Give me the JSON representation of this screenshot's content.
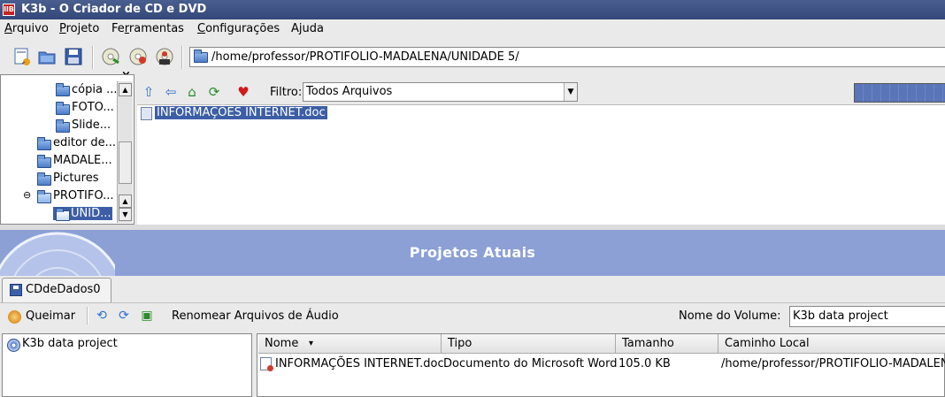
{
  "window": {
    "title": "K3b - O Criador de CD e DVD",
    "app_icon_text": "llB"
  },
  "menubar": [
    {
      "label": "Arquivo",
      "underline": 0
    },
    {
      "label": "Projeto",
      "underline": 0
    },
    {
      "label": "Ferramentas",
      "underline": 2
    },
    {
      "label": "Configurações",
      "underline": 0
    },
    {
      "label": "Ajuda",
      "underline": 1
    }
  ],
  "toolbar": {
    "path": "/home/professor/PROTIFOLIO-MADALENA/UNIDADE 5/",
    "icons": [
      "new-project-icon",
      "open-project-icon",
      "save-project-icon",
      "copy-cd-icon",
      "burn-cd-image-icon",
      "burn-dvd-image-icon"
    ]
  },
  "tree": {
    "close_glyph": "×",
    "items": [
      {
        "label": "cópia ...",
        "indent": 3
      },
      {
        "label": "FOTO...",
        "indent": 3
      },
      {
        "label": "Slide...",
        "indent": 3
      },
      {
        "label": "editor de...",
        "indent": 2
      },
      {
        "label": "MADALE...",
        "indent": 2
      },
      {
        "label": "Pictures",
        "indent": 2
      },
      {
        "label": "PROTIFO...",
        "indent": 2,
        "expanded": true,
        "expander": "⊖"
      },
      {
        "label": "UNID...",
        "indent": 3,
        "selected": true
      }
    ]
  },
  "filebrowser": {
    "nav_icons": [
      "up-arrow-icon",
      "back-arrow-icon",
      "home-icon",
      "reload-icon",
      "bookmark-heart-icon"
    ],
    "filter_label": "Filtro:",
    "filter_value": "Todos Arquivos",
    "files": [
      {
        "name": "INFORMAÇÕES INTERNET.doc",
        "selected": true
      }
    ]
  },
  "projects": {
    "header_title": "Projetos Atuais",
    "tab_label": "CDdeDados0",
    "burn_label": "Queimar",
    "rename_audio_label": "Renomear Arquivos de Áudio",
    "volume_label": "Nome do Volume:",
    "volume_value": "K3b data project",
    "root_label": "K3b data project",
    "columns": [
      "Nome",
      "Tipo",
      "Tamanho",
      "Caminho Local"
    ],
    "sort_indicator": "▾",
    "rows": [
      {
        "name": "INFORMAÇÕES INTERNET.doc",
        "type": "Documento do Microsoft Word",
        "size": "105.0 KB",
        "path": "/home/professor/PROTIFOLIO-MADALENA/"
      }
    ]
  },
  "colors": {
    "title_bar": "#3d5283",
    "selection": "#3d5ea6",
    "project_header": "#8ca0d6"
  }
}
